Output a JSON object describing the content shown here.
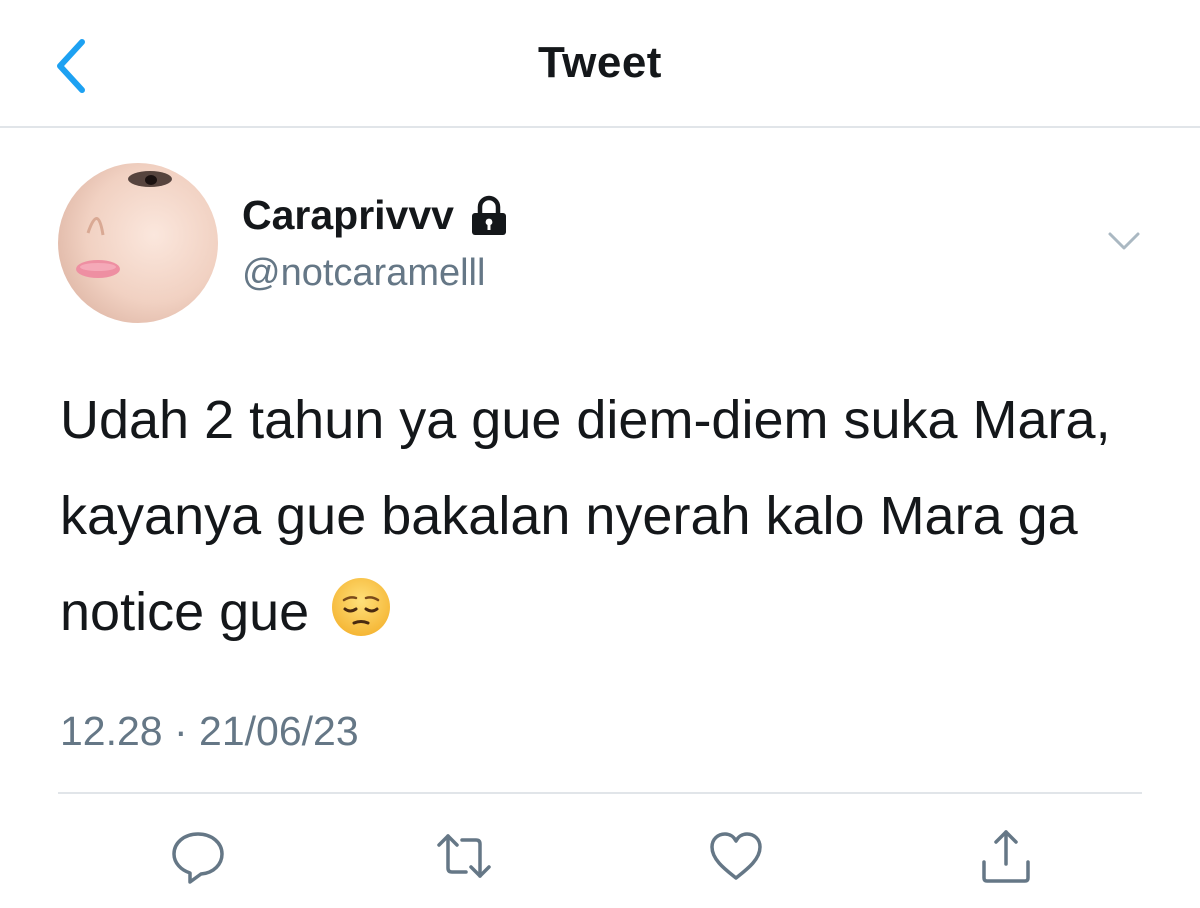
{
  "header": {
    "title": "Tweet",
    "back_icon": "chevron-left-icon"
  },
  "tweet": {
    "display_name": "Caraprivvv",
    "handle": "@notcaramelll",
    "locked_icon": "lock-icon",
    "text": "Udah 2 tahun ya gue diem-diem suka Mara, kayanya gue bakalan nyerah kalo Mara ga notice gue",
    "emoji": "pensive-face",
    "timestamp": "12.28 · 21/06/23"
  },
  "actions": [
    {
      "icon": "reply-icon"
    },
    {
      "icon": "retweet-icon"
    },
    {
      "icon": "like-icon"
    },
    {
      "icon": "share-icon"
    }
  ],
  "colors": {
    "accent": "#1da1f2",
    "text_primary": "#14171a",
    "text_secondary": "#657786",
    "divider": "#e1e5e9",
    "icon_gray": "#657786"
  }
}
